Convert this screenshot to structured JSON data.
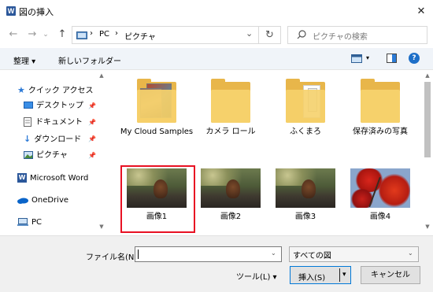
{
  "window": {
    "title": "図の挿入",
    "app_icon": "W",
    "close": "✕"
  },
  "nav": {
    "back": "←",
    "forward": "→",
    "dropdown": "⌄",
    "up": "↑"
  },
  "address": {
    "crumbs": [
      "PC",
      "ピクチャ"
    ],
    "sep": "›",
    "dropdown": "⌄",
    "refresh": "↻"
  },
  "search": {
    "placeholder": "ピクチャの検索"
  },
  "toolbar": {
    "organize": "整理 ▾",
    "new_folder": "新しいフォルダー",
    "view_dd": "▾",
    "help": "?"
  },
  "sidebar": {
    "quick_access": "クイック アクセス",
    "items": [
      {
        "label": "デスクトップ",
        "pin": "📌"
      },
      {
        "label": "ドキュメント",
        "pin": "📌"
      },
      {
        "label": "ダウンロード",
        "pin": "📌"
      },
      {
        "label": "ピクチャ",
        "pin": "📌"
      }
    ],
    "word": "Microsoft Word",
    "onedrive": "OneDrive",
    "pc": "PC"
  },
  "scroll": {
    "up": "▲",
    "down": "▼"
  },
  "folders": [
    {
      "label": "My Cloud Samples"
    },
    {
      "label": "カメラ ロール"
    },
    {
      "label": "ふくまろ"
    },
    {
      "label": "保存済みの写真"
    }
  ],
  "images": [
    {
      "label": "画像1",
      "selected": true
    },
    {
      "label": "画像2"
    },
    {
      "label": "画像3"
    },
    {
      "label": "画像4"
    }
  ],
  "colors": {
    "highlight": "#e81123",
    "folder": "#f6d16b",
    "accent": "#0078d7"
  },
  "footer": {
    "filename_label": "ファイル名(N):",
    "filename_value": "",
    "filetype": "すべての図",
    "dd": "⌄",
    "tools": "ツール(L) ▾",
    "insert": "挿入(S)",
    "insert_dd": "▾",
    "cancel": "キャンセル"
  }
}
